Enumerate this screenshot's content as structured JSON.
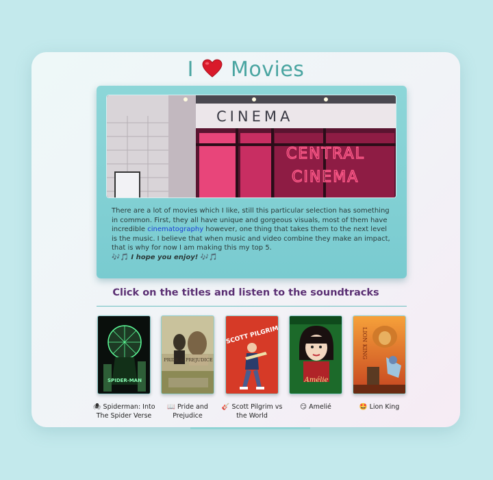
{
  "header": {
    "title_pre": "I",
    "title_post": "Movies",
    "heart_icon": "heart-icon"
  },
  "hero": {
    "sign_top": "CINEMA",
    "neon_line1": "CENTRAL",
    "neon_line2": "CINEMA"
  },
  "intro": {
    "text_before_link": "There are a lot of movies which I like, still this particular selection has something in common. First, they all have unique and gorgeous visuals, most of them have incredible ",
    "link": "cinematography",
    "text_after_link": " however, one thing that takes them to the next level is the music. I believe that when music and video combine they make an impact, that is why for now I am making this my top 5.",
    "enjoy_notes_left": "🎶🎵",
    "enjoy_text": "I hope you enjoy!",
    "enjoy_notes_right": "🎶🎵"
  },
  "soundtracks": {
    "heading": "Click on the titles and listen to the soundtracks",
    "movies": [
      {
        "emoji": "🕷",
        "title": "Spiderman: Into The Spider Verse",
        "poster_text": "SPIDER-MAN"
      },
      {
        "emoji": "📖",
        "title": "Pride and Prejudice",
        "poster_text": "PRIDE & PREJUDICE"
      },
      {
        "emoji": "🎸",
        "title": "Scott Pilgrim vs the World",
        "poster_text": "SCOTT PILGRIM"
      },
      {
        "emoji": "😏",
        "title": "Amelié",
        "poster_text": "Amélie"
      },
      {
        "emoji": "🤩",
        "title": "Lion King",
        "poster_text": "LION KING"
      }
    ]
  },
  "colors": {
    "title": "#4aa5a1",
    "heading": "#5a2f73",
    "panel": "#80cfd3",
    "link": "#1a3fd6"
  }
}
